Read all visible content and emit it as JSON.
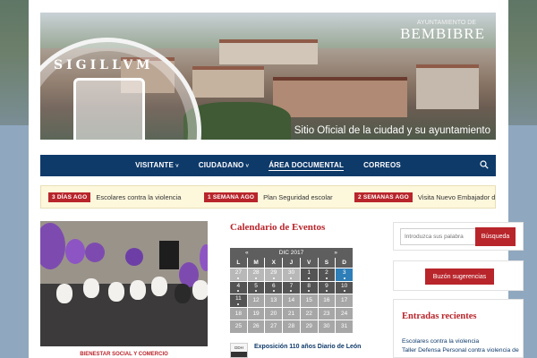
{
  "header": {
    "town_sup": "AYUNTAMIENTO DE",
    "town": "BEMBIBRE",
    "tagline": "Sitio Oficial de la ciudad y su ayuntamiento",
    "seal_text": "SIGILLVM"
  },
  "nav": {
    "items": [
      {
        "label": "VISITANTE",
        "dropdown": true
      },
      {
        "label": "CIUDADANO",
        "dropdown": true
      },
      {
        "label": "ÁREA DOCUMENTAL",
        "dropdown": false,
        "active": true
      },
      {
        "label": "CORREOS",
        "dropdown": false
      }
    ],
    "chevron": "˅",
    "search_icon": "search-icon"
  },
  "ticker": [
    {
      "badge": "3 DÍAS AGO",
      "text": "Escolares contra la violencia"
    },
    {
      "badge": "1 SEMANA AGO",
      "text": "Plan Seguridad escolar"
    },
    {
      "badge": "2 SEMANAS AGO",
      "text": "Visita Nuevo Embajador de C"
    }
  ],
  "featured": {
    "caption": "BIENESTAR SOCIAL Y COMERCIO"
  },
  "calendar": {
    "title": "Calendario de Eventos",
    "prev": "«",
    "month": "DIC 2017",
    "next": "»",
    "days": [
      "L",
      "M",
      "X",
      "J",
      "V",
      "S",
      "D"
    ],
    "weeks": [
      [
        "27",
        "28",
        "29",
        "30",
        "1",
        "2",
        "3"
      ],
      [
        "4",
        "5",
        "6",
        "7",
        "8",
        "9",
        "10"
      ],
      [
        "11",
        "12",
        "13",
        "14",
        "15",
        "16",
        "17"
      ],
      [
        "18",
        "19",
        "20",
        "21",
        "22",
        "23",
        "24"
      ],
      [
        "25",
        "26",
        "27",
        "28",
        "29",
        "30",
        "31"
      ]
    ],
    "event": {
      "date_label": "DDH",
      "title": "Exposición 110 años Diario de León"
    }
  },
  "sidebar": {
    "search_placeholder": "Introduzca sus palabra",
    "search_button": "Búsqueda",
    "suggest_button": "Buzón sugerencias",
    "recent_title": "Entradas recientes",
    "recent": [
      "Escolares contra la violencia",
      "Taller Defensa Personal contra violencia de"
    ]
  },
  "colors": {
    "nav": "#0e3a6a",
    "accent": "#b8252b",
    "today": "#2e7eb8"
  }
}
